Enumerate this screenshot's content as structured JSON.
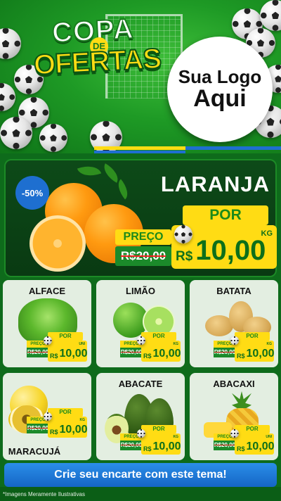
{
  "header": {
    "title_top": "COPA",
    "title_mid": "DE",
    "title_bottom": "OFERTAS",
    "logo_line1": "Sua Logo",
    "logo_line2": "Aqui"
  },
  "colors": {
    "green_dark": "#0e6b1b",
    "yellow": "#ffdc14",
    "blue": "#1e6fd0",
    "strike_red": "#e22222"
  },
  "hero": {
    "discount": "-50%",
    "name": "LARANJA",
    "por_label": "POR",
    "preco_label": "PREÇO",
    "old_currency": "R$",
    "old_price": "20,00",
    "currency": "R$",
    "price": "10,00",
    "unit": "KG"
  },
  "products": [
    {
      "name": "ALFACE",
      "por": "POR",
      "preco": "PREÇO",
      "old": "20,00",
      "currency": "R$",
      "price": "10,00",
      "unit": "UNI",
      "old_prefix": "R$"
    },
    {
      "name": "LIMÃO",
      "por": "POR",
      "preco": "PREÇO",
      "old": "20,00",
      "currency": "R$",
      "price": "10,00",
      "unit": "KG",
      "old_prefix": "R$"
    },
    {
      "name": "BATATA",
      "por": "POR",
      "preco": "PREÇO",
      "old": "20,00",
      "currency": "R$",
      "price": "10,00",
      "unit": "KG",
      "old_prefix": "R$"
    },
    {
      "name": "MARACUJÁ",
      "por": "POR",
      "preco": "PREÇO",
      "old": "20,00",
      "currency": "R$",
      "price": "10,00",
      "unit": "KG",
      "old_prefix": "R$"
    },
    {
      "name": "ABACATE",
      "por": "POR",
      "preco": "PREÇO",
      "old": "20,00",
      "currency": "R$",
      "price": "10,00",
      "unit": "KG",
      "old_prefix": "R$"
    },
    {
      "name": "ABACAXI",
      "por": "POR",
      "preco": "PREÇO",
      "old": "20,00",
      "currency": "R$",
      "price": "10,00",
      "unit": "UNI",
      "old_prefix": "R$"
    }
  ],
  "cta": "Crie seu encarte com este tema!",
  "footnote": "*Imagens Meramente Ilustrativas"
}
